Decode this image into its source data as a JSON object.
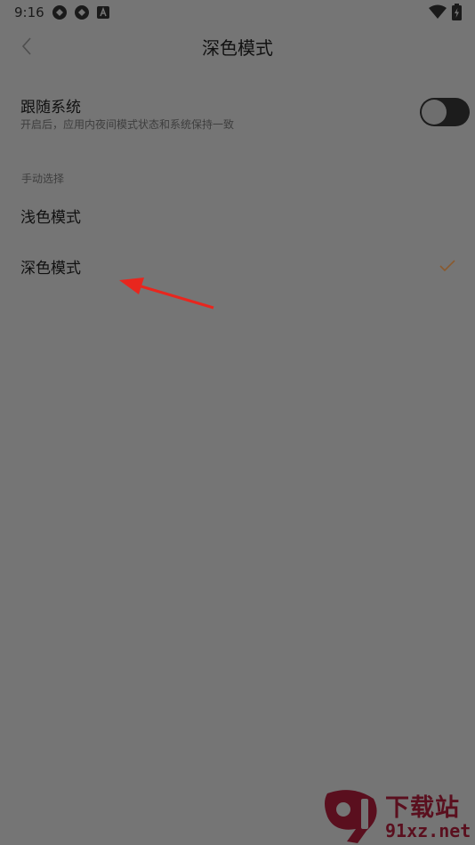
{
  "status_bar": {
    "time": "9:16",
    "icons": [
      "sync-icon",
      "sync-icon",
      "font-icon",
      "wifi-icon",
      "battery-charging-icon"
    ]
  },
  "header": {
    "back_icon": "chevron-left-icon",
    "title": "深色模式"
  },
  "follow_system": {
    "title": "跟随系统",
    "description": "开启后，应用内夜间模式状态和系统保持一致",
    "enabled": false
  },
  "manual": {
    "section_label": "手动选择",
    "options": [
      {
        "label": "浅色模式",
        "selected": false
      },
      {
        "label": "深色模式",
        "selected": true
      }
    ]
  },
  "annotation": {
    "arrow_color": "#e8261e"
  },
  "watermark": {
    "logo_text": "91",
    "name": "下载站",
    "domain": "91xz.net",
    "color": "#5a0f1e"
  },
  "colors": {
    "background": "#757575",
    "accent_check": "#8a5a2e",
    "toggle_track": "#1c1c1c"
  }
}
